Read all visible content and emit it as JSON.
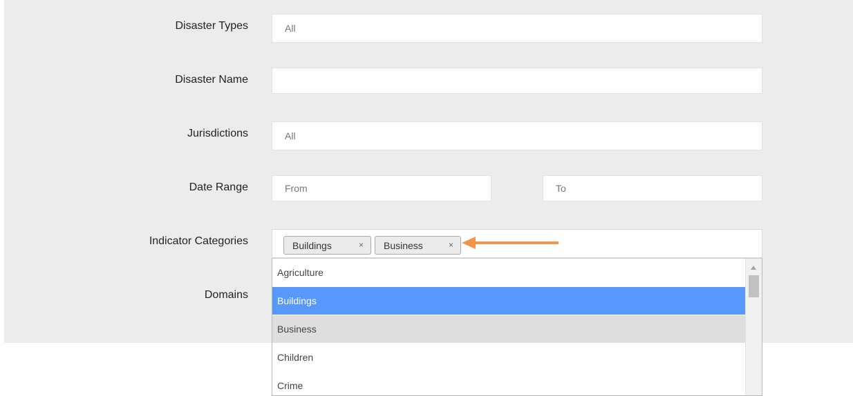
{
  "form": {
    "disaster_types": {
      "label": "Disaster Types",
      "value": "All"
    },
    "disaster_name": {
      "label": "Disaster Name",
      "value": ""
    },
    "jurisdictions": {
      "label": "Jurisdictions",
      "value": "All"
    },
    "date_range": {
      "label": "Date Range",
      "from_placeholder": "From",
      "to_placeholder": "To"
    },
    "indicator_categories": {
      "label": "Indicator Categories",
      "tags": [
        {
          "label": "Buildings",
          "remove": "×"
        },
        {
          "label": "Business",
          "remove": "×"
        }
      ]
    },
    "domains": {
      "label": "Domains"
    }
  },
  "dropdown": {
    "options": [
      "Agriculture",
      "Buildings",
      "Business",
      "Children",
      "Crime"
    ],
    "highlighted": "Buildings",
    "selected": [
      "Buildings",
      "Business"
    ]
  },
  "colors": {
    "highlight": "#5897fb",
    "selected_option": "#dedede",
    "annotation_arrow": "#f0954a",
    "panel": "#ececec"
  }
}
